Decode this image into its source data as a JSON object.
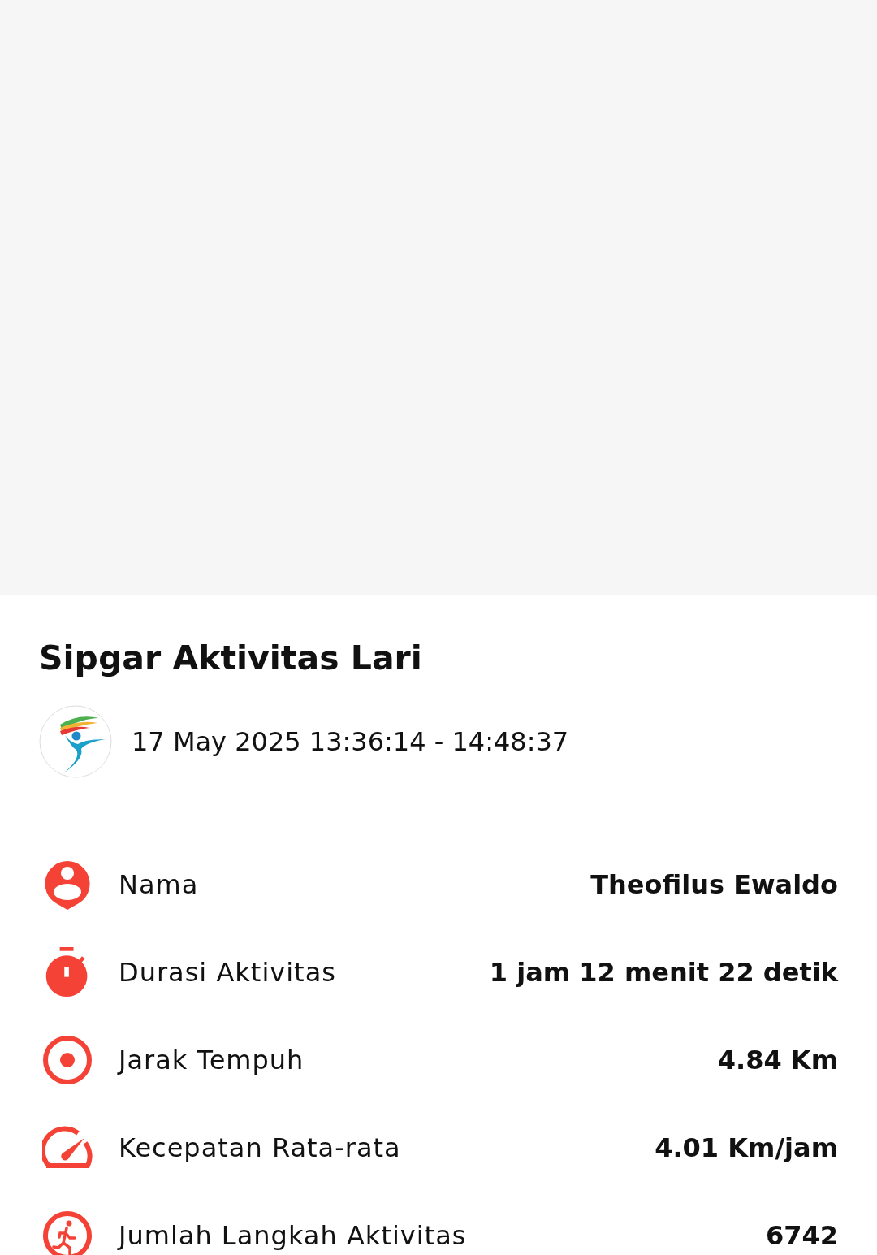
{
  "title": "Sipgar Aktivitas Lari",
  "datetime": "17 May 2025 13:36:14 - 14:48:37",
  "stats": [
    {
      "kind": "person",
      "label": "Nama",
      "value": "Theofilus Ewaldo"
    },
    {
      "kind": "timer",
      "label": "Durasi Aktivitas",
      "value": "1 jam 12 menit 22 detik"
    },
    {
      "kind": "distance",
      "label": "Jarak Tempuh",
      "value": "4.84 Km"
    },
    {
      "kind": "speed",
      "label": "Kecepatan Rata-rata",
      "value": "4.01 Km/jam"
    },
    {
      "kind": "steps",
      "label": "Jumlah Langkah Aktivitas",
      "value": "6742"
    }
  ]
}
